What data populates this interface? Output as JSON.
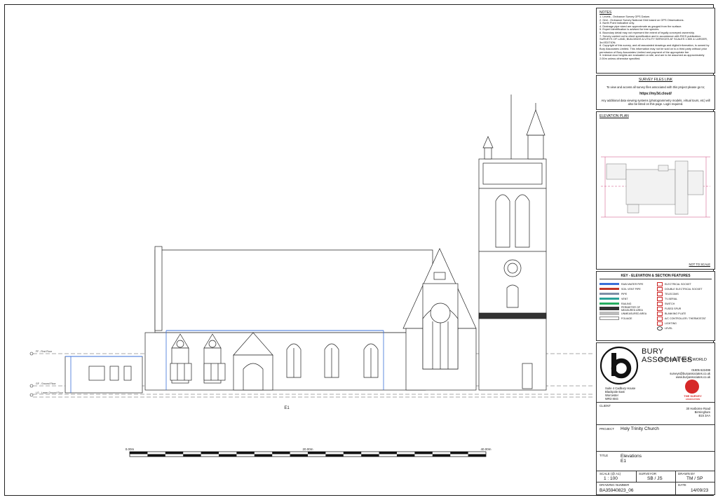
{
  "notes": {
    "title": "NOTES",
    "items": [
      "1. Levels - Ordnance Survey GPS Datum.",
      "2. Grid - Ordnance Survey National Grid based on GPS Observations.",
      "3. North Point indicative only.",
      "4. Drainage pipe sized are approximate as gauged from the surface.",
      "5. Expert identification is advised for tree species.",
      "6. Boundary detail may not represent the extent of legally conveyed ownership.",
      "7. Survey carried out to client specification and in accordance with RICS publication: SURVEYS OF LAND, BUILDINGS & UTILITY SERVICES AT SCALES 1:500 & LARGER, 3rd EDITION.",
      "8. Copyright of this survey, and all associated drawings and digital information, is owned by Bury Associates Limited. This information may not be sold on to a third party without prior permission of Bury Associates Limited and payment of the appropriate fee.",
      "9. Internal door heights are evaluated on site, and are to be assumed as approximately 2.00m unless otherwise specified."
    ]
  },
  "survey_files": {
    "title": "SURVEY FILES LINK",
    "intro": "To view and access all survey files associated with this project please go to;",
    "link": "https://my3d.cloud/",
    "note": "Any additional data viewing systems (photogrammetry models, virtual tours, etc) will also be listed on this page. Login required."
  },
  "elevation_plan": {
    "title": "ELEVATION PLAN",
    "not_to_scale": "NOT TO SCALE"
  },
  "key": {
    "title": "KEY - ELEVATION & SECTION FEATURES",
    "left": [
      {
        "label": "RAIN WATER PIPE",
        "color": "#3a6fd8"
      },
      {
        "label": "SOIL VENT PIPE",
        "color": "#c0392b"
      },
      {
        "label": "PIPE",
        "color": "#7f8fa6"
      },
      {
        "label": "VENT",
        "color": "#2aa198"
      },
      {
        "label": "RAILING",
        "color": "#27ae60"
      },
      {
        "label": "PERIMETER OF MEASURED AREA",
        "color": "#333333"
      },
      {
        "label": "UNMEASURED AREA",
        "color": "#bbbbbb"
      },
      {
        "label": "FOLIAGE",
        "color": "#888888"
      }
    ],
    "right": [
      {
        "label": "ELECTRICAL SOCKET"
      },
      {
        "label": "DOUBLE ELECTRICAL SOCKET"
      },
      {
        "label": "TELECOMS"
      },
      {
        "label": "TV AERIAL"
      },
      {
        "label": "SWITCH"
      },
      {
        "label": "FUSED SPUR"
      },
      {
        "label": "BLANKING PLATE"
      },
      {
        "label": "A/C CONTROLLER / THERMOSTAT"
      },
      {
        "label": "LIGHTING"
      },
      {
        "label": "LEVEL"
      }
    ]
  },
  "company": {
    "name": "BURY ASSOCIATES",
    "tagline": "DIGITISING YOUR WORLD",
    "phone": "01905 622499",
    "email": "surveys@buryassociates.co.uk",
    "web": "www.buryassociates.co.uk",
    "address": [
      "Suite 4 Cadbury House",
      "Blackpole East",
      "Worcester",
      "WR3 8SG"
    ],
    "badge_line1": "THE SURVEY",
    "badge_line2": "ASSOCIATION"
  },
  "client": {
    "label": "CLIENT",
    "address": [
      "30 Harborne Road",
      "Birmingham",
      "B15 3AA"
    ]
  },
  "project": {
    "label": "PROJECT",
    "value": "Holy Trinity Church"
  },
  "title_block": {
    "label": "TITLE",
    "value_line1": "Elevations",
    "value_line2": "E1"
  },
  "scale": {
    "label": "SCALE (@ A1)",
    "value": "1 : 100"
  },
  "surveyor": {
    "label": "SURVEYOR",
    "value": "SB / JS"
  },
  "drawn_by": {
    "label": "DRAWN BY",
    "value": "TM / SP"
  },
  "drawing_number": {
    "label": "DRAWING NUMBER",
    "value": "BA35940823_06"
  },
  "date": {
    "label": "DATE",
    "value": "14/09/23"
  },
  "elevation": {
    "label": "E1",
    "scalebar": [
      "0.00m",
      "20.00m",
      "40.00m"
    ],
    "levels": [
      "FF - First Floor",
      "GF - Ground Floor",
      "LG - Lower Ground Floor"
    ]
  }
}
